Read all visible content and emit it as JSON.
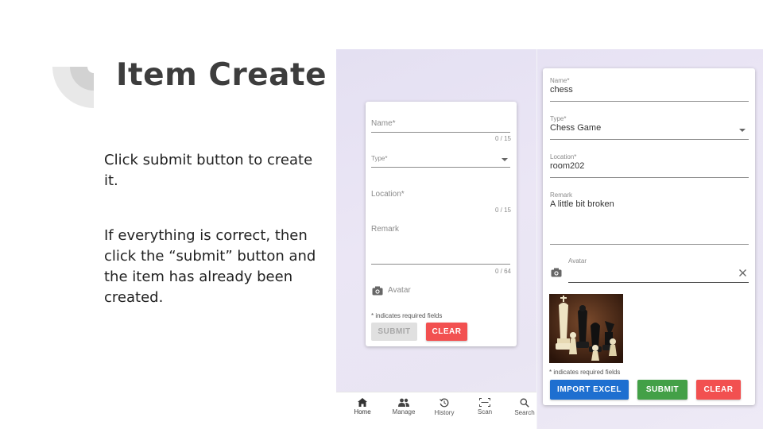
{
  "slide": {
    "title": "Item Create",
    "paragraph1": "Click submit button to create it.",
    "paragraph2": "If everything is correct, then click the “submit” button and the item has already been created."
  },
  "left_form": {
    "name_label": "Name*",
    "name_counter": "0 / 15",
    "type_label": "Type*",
    "location_label": "Location*",
    "location_counter": "0 / 15",
    "remark_label": "Remark",
    "remark_counter": "0 / 64",
    "avatar_label": "Avatar",
    "required_hint": "* indicates required fields",
    "submit_label": "SUBMIT",
    "clear_label": "CLEAR"
  },
  "right_form": {
    "name_label": "Name*",
    "name_value": "chess",
    "type_label": "Type*",
    "type_value": "Chess Game",
    "location_label": "Location*",
    "location_value": "room202",
    "remark_label": "Remark",
    "remark_value": "A little bit broken",
    "avatar_label": "Avatar",
    "required_hint": "* indicates required fields",
    "import_label": "IMPORT EXCEL",
    "submit_label": "SUBMIT",
    "clear_label": "CLEAR"
  },
  "bottom_nav": {
    "items": [
      {
        "label": "Home",
        "icon": "home-icon"
      },
      {
        "label": "Manage",
        "icon": "people-icon"
      },
      {
        "label": "History",
        "icon": "history-icon"
      },
      {
        "label": "Scan",
        "icon": "scan-icon"
      },
      {
        "label": "Search",
        "icon": "search-icon"
      }
    ]
  },
  "colors": {
    "clear": "#f25050",
    "submit": "#43a047",
    "import": "#1e6fd0",
    "title": "#3d3d3d"
  }
}
